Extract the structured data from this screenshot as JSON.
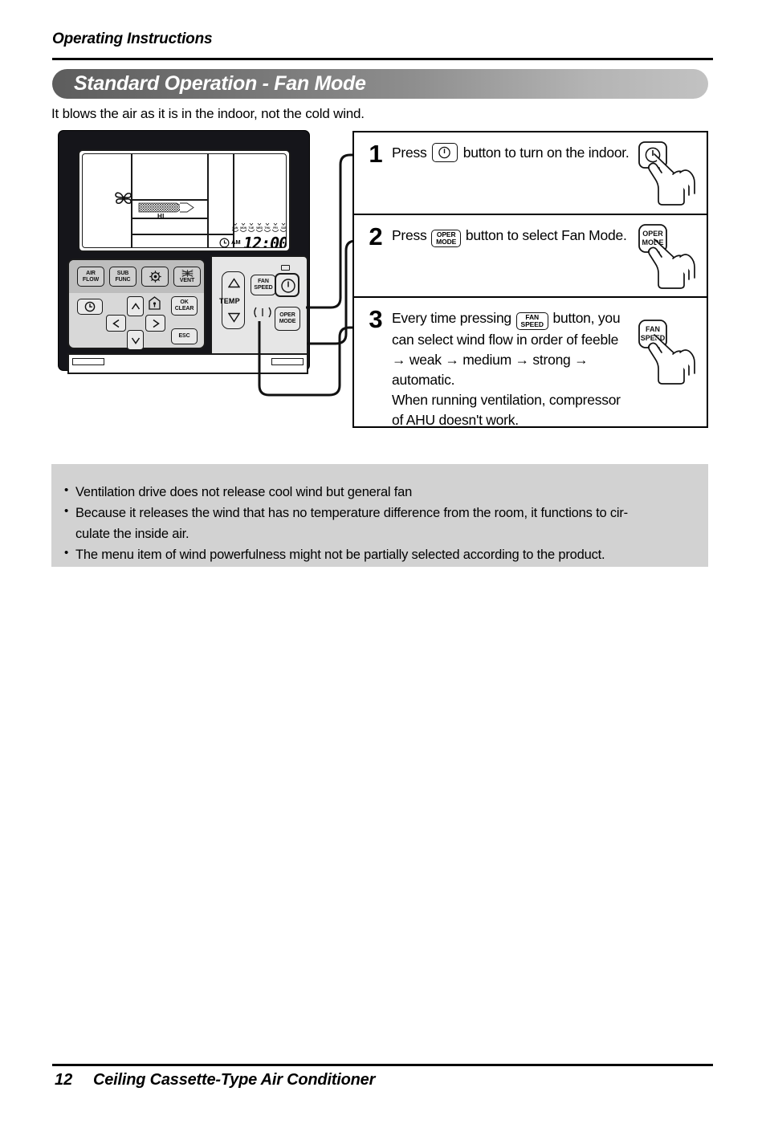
{
  "header": {
    "running_head": "Operating Instructions",
    "banner_title": "Standard Operation - Fan Mode",
    "intro": "It blows the air as it is in the indoor, not the cold wind."
  },
  "remote": {
    "lcd": {
      "fan_icon": "fan-blade-icon",
      "airflow_level_label": "HI",
      "clock_icon": "clock-icon",
      "meridiem": "AM",
      "time": "12:00",
      "days": [
        "SUN",
        "MON",
        "TUE",
        "WED",
        "THU",
        "FRI",
        "SAT"
      ]
    },
    "left_buttons": [
      {
        "name": "air-flow",
        "l1": "AIR",
        "l2": "FLOW"
      },
      {
        "name": "sub-func",
        "l1": "SUB",
        "l2": "FUNC"
      },
      {
        "name": "setting",
        "l1": "",
        "l2": "",
        "icon": "gear-icon"
      },
      {
        "name": "vent",
        "l1": "",
        "l2": "VENT",
        "icon": "vent-icon"
      },
      {
        "name": "timer",
        "l1": "",
        "l2": "",
        "icon": "clock-icon"
      },
      {
        "name": "ok-clear",
        "l1": "OK",
        "l2": "CLEAR"
      },
      {
        "name": "esc",
        "l1": "ESC",
        "l2": ""
      }
    ],
    "right_buttons": {
      "temp_label": "TEMP",
      "fan_speed_l1": "FAN",
      "fan_speed_l2": "SPEED",
      "oper_mode_l1": "OPER",
      "oper_mode_l2": "MODE",
      "power_icon": "power-icon"
    }
  },
  "steps": [
    {
      "num": "1",
      "pre": "Press",
      "btn": {
        "type": "power",
        "l1": "",
        "l2": ""
      },
      "post": "button to turn on the indoor.",
      "callout": {
        "type": "power",
        "l1": "",
        "l2": ""
      }
    },
    {
      "num": "2",
      "pre": "Press",
      "btn": {
        "type": "text",
        "l1": "OPER",
        "l2": "MODE"
      },
      "post": "button to select Fan Mode.",
      "callout": {
        "type": "text",
        "l1": "OPER",
        "l2": "MODE"
      }
    },
    {
      "num": "3",
      "pre": "Every time pressing",
      "btn": {
        "type": "text",
        "l1": "FAN",
        "l2": "SPEED"
      },
      "post": "button, you can select wind flow in order of feeble → weak → medium → strong → automatic.",
      "post2": "When running ventilation, compressor of AHU doesn't work.",
      "callout": {
        "type": "text",
        "l1": "FAN",
        "l2": "SPEED"
      }
    }
  ],
  "notes": {
    "bullet": "•",
    "items": [
      "Ventilation drive does not release cool wind but general fan",
      "Because it releases the wind that has no temperature difference from the room, it functions to cir-culate the inside air.",
      "The menu item of wind powerfulness might not be partially selected according to the product."
    ],
    "item2_line1": "Because it releases the wind that has no temperature difference from the room, it functions to cir-",
    "item2_line2": "culate the inside air.",
    "background": "#d2d2d2"
  },
  "footer": {
    "page_number": "12",
    "title": "Ceiling Cassette-Type Air Conditioner"
  }
}
